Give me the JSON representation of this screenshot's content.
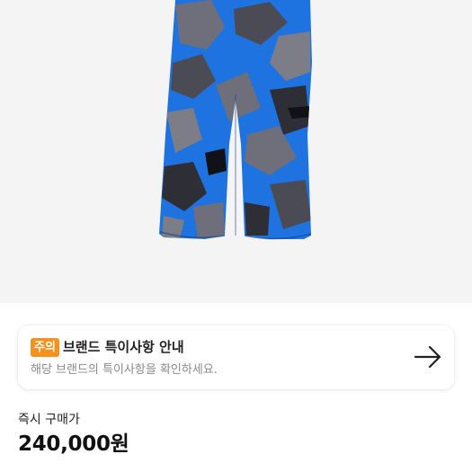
{
  "notice": {
    "badge": "주의",
    "title": "브랜드 특이사항 안내",
    "description": "해당 브랜드의 특이사항을 확인하세요."
  },
  "price": {
    "label": "즉시 구매가",
    "value": "240,000원"
  },
  "colors": {
    "image_background": "#f4f4f4",
    "badge": "#f5921e",
    "camo_blue": "#1f73e0",
    "camo_gray": "#6e6f7a"
  }
}
